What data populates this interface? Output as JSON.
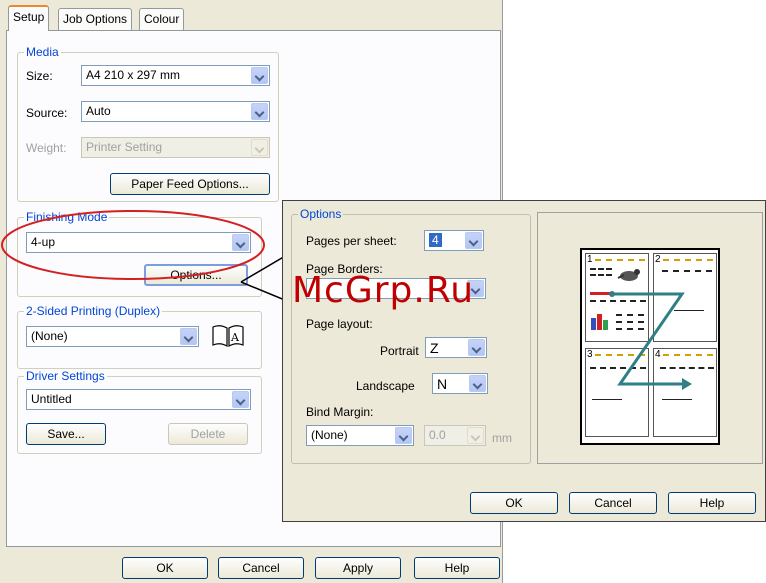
{
  "tabs": [
    {
      "label": "Setup"
    },
    {
      "label": "Job Options"
    },
    {
      "label": "Colour"
    }
  ],
  "media": {
    "legend": "Media",
    "size_label": "Size:",
    "size_value": "A4 210 x 297 mm",
    "source_label": "Source:",
    "source_value": "Auto",
    "weight_label": "Weight:",
    "weight_value": "Printer Setting",
    "paper_feed_button": "Paper Feed Options..."
  },
  "finishing": {
    "legend": "Finishing Mode",
    "value": "4-up",
    "options_button": "Options..."
  },
  "duplex": {
    "legend": "2-Sided Printing (Duplex)",
    "value": "(None)",
    "book_glyph": "A"
  },
  "driver": {
    "legend": "Driver Settings",
    "value": "Untitled",
    "save_button": "Save...",
    "delete_button": "Delete"
  },
  "main_buttons": {
    "ok": "OK",
    "cancel": "Cancel",
    "apply": "Apply",
    "help": "Help"
  },
  "options": {
    "legend": "Options",
    "pages_per_sheet_label": "Pages per sheet:",
    "pages_per_sheet_value": "4",
    "page_borders_label": "Page Borders:",
    "page_layout_label": "Page layout:",
    "portrait_label": "Portrait",
    "portrait_value": "Z",
    "landscape_label": "Landscape",
    "landscape_value": "N",
    "bind_margin_label": "Bind Margin:",
    "bind_margin_value": "(None)",
    "margin_value": "0.0",
    "margin_unit": "mm",
    "ok": "OK",
    "cancel": "Cancel",
    "help": "Help"
  },
  "preview": {
    "cell_numbers": [
      "1",
      "2",
      "3",
      "4"
    ]
  },
  "watermark": "McGrp.Ru",
  "colors": {
    "highlight_ellipse": "#d42020",
    "flow_arrow": "#2f7f84",
    "legend_text": "#0046d5"
  }
}
